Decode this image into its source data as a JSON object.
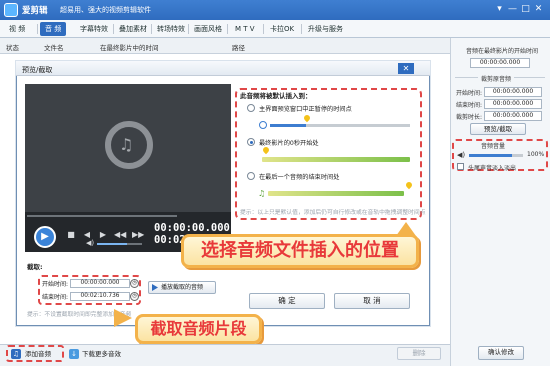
{
  "app": {
    "name": "爱剪辑",
    "slogan": "超易用、强大的视频剪辑软件",
    "win_controls": [
      "▾",
      "—",
      "□",
      "✕"
    ]
  },
  "menu": {
    "tabs": [
      "视 频",
      "音 频",
      "字幕特效",
      "叠加素材",
      "转场特效",
      "画面风格",
      "M T V",
      "卡拉OK",
      "升级与服务"
    ],
    "active_index": 1
  },
  "list_header": [
    "状态",
    "文件名",
    "在最终影片中的时间",
    "路径"
  ],
  "right_panel": {
    "start_label": "音频在最终影片的开始时间",
    "start_value": "00:00:00.000",
    "cut_title": "裁剪原音频",
    "start_time_label": "开始时间:",
    "start_time_value": "00:00:00.000",
    "end_time_label": "结束时间:",
    "end_time_value": "00:00:00.000",
    "cut_duration_label": "裁剪时长:",
    "cut_duration_value": "00:00:00.000",
    "preview_button": "预览/截取",
    "volume_title": "音频音量",
    "volume_value": "100%",
    "volume_level": 0.8,
    "fade_label": "头尾声音淡入淡出",
    "confirm_button": "确认修改"
  },
  "dialog": {
    "title": "预览/截取",
    "close": "✕",
    "player": {
      "time_current": "00:00:00.000",
      "time_total": "00:02:10.736",
      "play_icon": "play-icon",
      "note_glyph": "♫"
    },
    "insert": {
      "header": "此音频将被默认插入到：",
      "option1": "主界面预览窗口中正暂停的时间点",
      "option2": "最终影片的0秒开始处",
      "option3": "在最后一个音频的结束时间处",
      "selected_index": 1,
      "hint": "提示：以上只是默认值，添加后仍可自行修改或在音轨中拖拽调整时间点"
    },
    "cut": {
      "label": "截取:",
      "start_label": "开始时间:",
      "start_value": "00:00:00.000",
      "end_label": "结束时间:",
      "end_value": "00:02:10.736",
      "play_button": "播放截取的音频",
      "note": "提示：不设置截取时间即完整添加该音频"
    },
    "ok_button": "确 定",
    "cancel_button": "取 消"
  },
  "bottom_bar": {
    "add_audio": "添加音频",
    "download_more": "下载更多音效",
    "delete": "删除"
  },
  "callouts": {
    "insert_position": "选择音频文件插入的位置",
    "cut_audio": "截取音频片段"
  },
  "colors": {
    "accent": "#2f6cbf",
    "highlight_border": "#e04848",
    "banner_text": "#e8393a",
    "banner_fill": "#fbe3a2"
  }
}
